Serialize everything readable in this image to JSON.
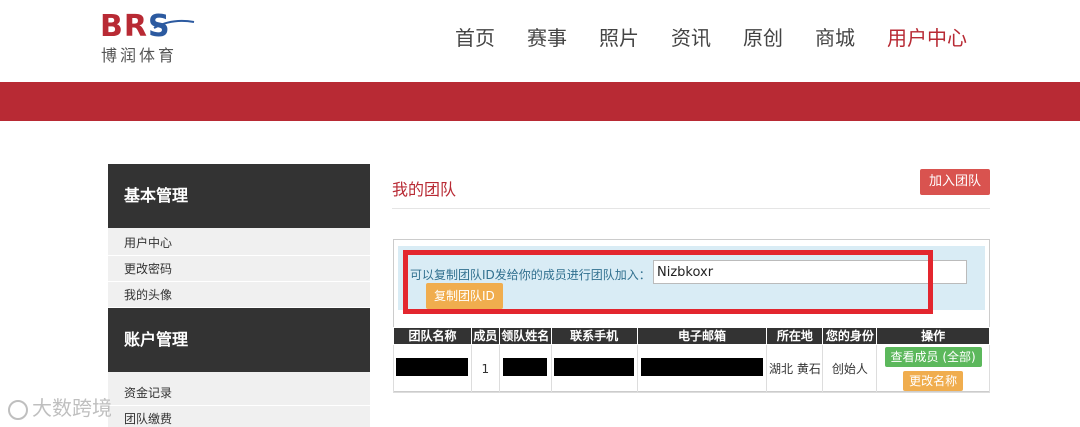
{
  "logo": {
    "mark_b": "B",
    "mark_r": "R",
    "mark_s": "S",
    "cn": "博润体育",
    "brand_red": "#b82a34",
    "brand_blue": "#2c5aa0"
  },
  "nav": {
    "items": [
      "首页",
      "赛事",
      "照片",
      "资讯",
      "原创",
      "商城",
      "用户中心"
    ],
    "active": "用户中心"
  },
  "sidebar": {
    "section1": {
      "title": "基本管理",
      "items": [
        "用户中心",
        "更改密码",
        "我的头像"
      ]
    },
    "section2": {
      "title": "账户管理",
      "items": [
        "资金记录",
        "团队缴费"
      ]
    }
  },
  "main": {
    "title": "我的团队",
    "join_button": "加入团队",
    "info_text": "可以复制团队ID发给你的成员进行团队加入：",
    "team_id": "Nizbkoxr",
    "copy_button": "复制团队ID"
  },
  "table": {
    "headers": [
      "团队名称",
      "成员",
      "领队姓名",
      "联系手机",
      "电子邮箱",
      "所在地",
      "您的身份",
      "操作"
    ],
    "rows": [
      {
        "members": "1",
        "location": "湖北 黄石",
        "role": "创始人",
        "view_button": "查看成员 (全部)",
        "rename_button": "更改名称"
      }
    ]
  },
  "watermark": "大数跨境",
  "colors": {
    "accent": "#b82a34",
    "highlight": "#e3262e",
    "info_bg": "#d9ecf5",
    "sidebar_head": "#333333"
  }
}
